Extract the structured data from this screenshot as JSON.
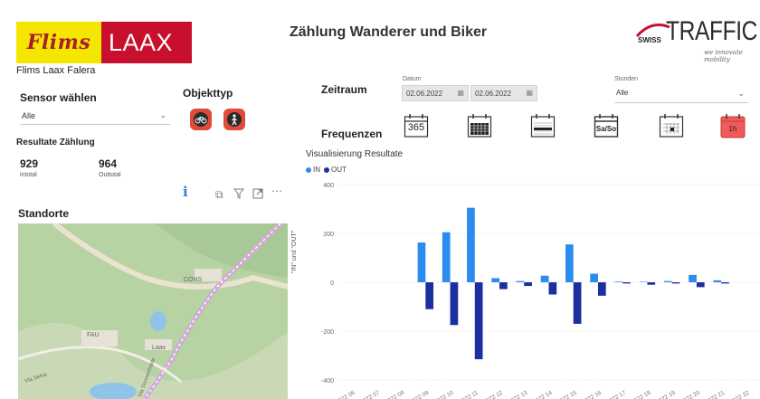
{
  "header": {
    "logo_left": "Flims",
    "logo_right": "LAAX",
    "org_name": "Flims Laax Falera",
    "page_title": "Zählung  Wanderer und Biker",
    "brand_prefix": "SWISS",
    "brand_name": "TRAFFIC",
    "brand_tagline": "we innovate mobility"
  },
  "filters": {
    "sensor_label": "Sensor wählen",
    "sensor_value": "Alle",
    "objekttyp_label": "Objekttyp",
    "objekttyp_buttons": [
      "bike-icon",
      "pedestrian-icon"
    ],
    "zeitraum_label": "Zeitraum",
    "datum_label": "Datum",
    "date_from": "02.06.2022",
    "date_to": "02.06.2022",
    "stunden_label": "Stunden",
    "stunden_value": "Alle",
    "frequenzen_label": "Frequenzen",
    "frequency_buttons": [
      {
        "icon": "year-calendar-icon",
        "text": "365"
      },
      {
        "icon": "month-calendar-icon",
        "text": ""
      },
      {
        "icon": "week-calendar-icon",
        "text": ""
      },
      {
        "icon": "weekend-calendar-icon",
        "text": "Sa/So"
      },
      {
        "icon": "day-calendar-icon",
        "text": ""
      },
      {
        "icon": "hour-calendar-icon",
        "text": "1h",
        "active": true
      }
    ]
  },
  "results": {
    "title": "Resultate Zählung",
    "in_total": "929",
    "in_label": "intotal",
    "out_total": "964",
    "out_label": "Outtotal"
  },
  "standorte": {
    "title": "Standorte",
    "map_labels": [
      "CONS",
      "FAU",
      "Laax",
      "Via Sonnenhalde",
      "Via Selva"
    ]
  },
  "colors": {
    "in": "#2b8cf0",
    "out": "#1c2f9e",
    "active_freq": "#f05a5a",
    "objekt_btn": "#e04a3a"
  },
  "chart_data": {
    "type": "bar",
    "title": "Visualisierung Resultate",
    "legend": [
      "IN",
      "OUT"
    ],
    "ylabel": "\"IN\" und \"OUT\"",
    "ylim": [
      -400,
      400
    ],
    "yticks": [
      400,
      200,
      0,
      -200,
      -400
    ],
    "categories": [
      "/2022 06",
      "/2022 07",
      "/2022 08",
      "/2022 09",
      "/2022 10",
      "/2022 11",
      "/2022 12",
      "/2022 13",
      "/2022 14",
      "/2022 15",
      "/2022 16",
      "/2022 17",
      "/2022 18",
      "/2022 19",
      "/2022 20",
      "/2022 21",
      "/2022 22"
    ],
    "series": [
      {
        "name": "IN",
        "values": [
          0,
          0,
          0,
          163,
          205,
          305,
          17,
          5,
          27,
          155,
          35,
          3,
          2,
          5,
          30,
          8,
          0
        ]
      },
      {
        "name": "OUT",
        "values": [
          0,
          0,
          0,
          -110,
          -175,
          -315,
          -28,
          -15,
          -50,
          -170,
          -55,
          -5,
          -10,
          -5,
          -20,
          -5,
          0
        ]
      }
    ],
    "grid": true,
    "legend_position": "top-left"
  }
}
